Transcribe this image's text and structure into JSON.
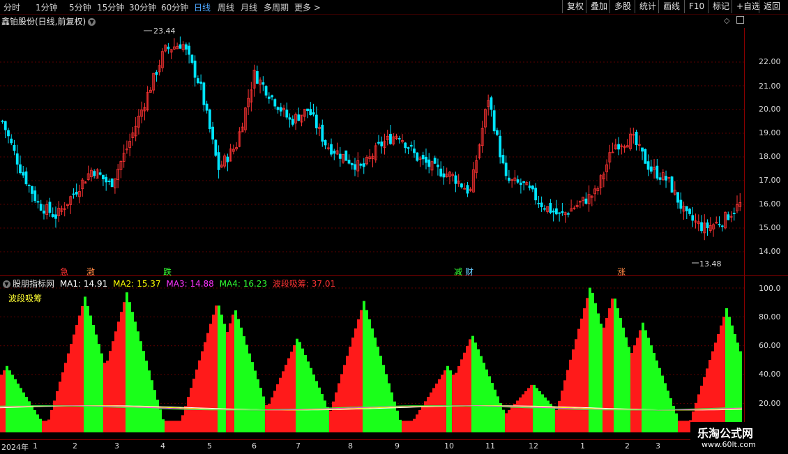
{
  "toolbar": {
    "timeframes": [
      "分时",
      "1分钟",
      "5分钟",
      "15分钟",
      "30分钟",
      "60分钟",
      "日线",
      "周线",
      "月线",
      "多周期",
      "更多 >"
    ],
    "active_timeframe": "日线",
    "right_buttons": [
      "复权",
      "叠加",
      "多股",
      "统计",
      "画线",
      "F10",
      "标记",
      "+自选",
      "返回"
    ]
  },
  "stock": {
    "title": "鑫铂股份(日线,前复权)"
  },
  "price_axis": {
    "labels": [
      "22.00",
      "21.00",
      "20.00",
      "19.00",
      "18.00",
      "17.00",
      "16.00",
      "15.00",
      "14.00"
    ]
  },
  "price_extremes": {
    "high": "23.44",
    "low": "13.48"
  },
  "signals": [
    {
      "text": "急",
      "color": "#ff3333"
    },
    {
      "text": "激",
      "color": "#ff8844"
    },
    {
      "text": "跌",
      "color": "#33ff33"
    },
    {
      "text": "减",
      "color": "#33ff33"
    },
    {
      "text": "财",
      "color": "#66ccff"
    },
    {
      "text": "涨",
      "color": "#ff8844"
    }
  ],
  "indicator": {
    "name": "股朋指标网",
    "ma1_label": "MA1:",
    "ma1": "14.91",
    "ma2_label": "MA2:",
    "ma2": "15.37",
    "ma3_label": "MA3:",
    "ma3": "14.88",
    "ma4_label": "MA4:",
    "ma4": "16.23",
    "band_label": "波段吸筹:",
    "band": "37.01",
    "subtitle": "波段吸筹",
    "axis_labels": [
      "100.0",
      "80.00",
      "60.00",
      "40.00",
      "20.00"
    ]
  },
  "x_axis": {
    "year": "2024年",
    "months": [
      "1",
      "2",
      "3",
      "4",
      "5",
      "6",
      "7",
      "8",
      "9",
      "10",
      "11",
      "12",
      "1",
      "2",
      "3"
    ]
  },
  "watermark": {
    "line1": "乐淘公式网",
    "line2": "www.60lt.com"
  },
  "colors": {
    "up": "#ff3333",
    "down": "#00e5ff",
    "bar_up": "#ff1a1a",
    "bar_down": "#1aff1a",
    "ma1": "#ffffff",
    "ma2": "#ffff00",
    "ma3": "#ff33ff",
    "ma4": "#33ff33",
    "band": "#ff3333"
  },
  "chart_data": {
    "type": "candlestick",
    "price_close_samples": [
      19.5,
      17.5,
      16.0,
      15.5,
      16.5,
      17.5,
      16.8,
      18.5,
      20.5,
      22.5,
      22.8,
      21.0,
      17.5,
      18.5,
      21.5,
      20.5,
      19.5,
      20.0,
      18.5,
      18.0,
      17.5,
      18.5,
      19.0,
      18.0,
      17.5,
      17.2,
      16.5,
      20.5,
      17.0,
      16.8,
      16.0,
      15.5,
      16.0,
      16.5,
      18.5,
      18.8,
      17.5,
      17.0,
      15.5,
      15.0,
      15.3,
      16.0
    ],
    "ylim": [
      13.5,
      23.5
    ],
    "indicator_range": [
      0,
      100
    ]
  }
}
